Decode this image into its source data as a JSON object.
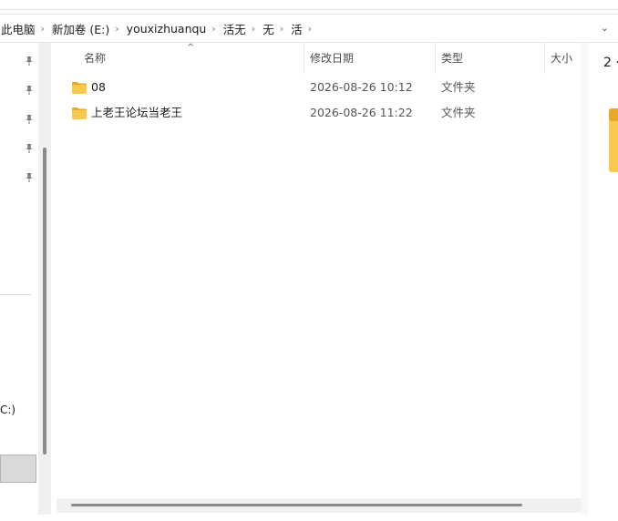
{
  "breadcrumb": [
    {
      "label": "此电脑"
    },
    {
      "label": "新加卷 (E:)"
    },
    {
      "label": "youxizhuanqu"
    },
    {
      "label": "活无"
    },
    {
      "label": "无"
    },
    {
      "label": "活"
    }
  ],
  "nav": {
    "drive_label": "C:)"
  },
  "columns": {
    "name": "名称",
    "date": "修改日期",
    "type": "类型",
    "size": "大小"
  },
  "files": [
    {
      "name": "08",
      "date": "2026-08-26 10:12",
      "type": "文件夹"
    },
    {
      "name": "上老王论坛当老王",
      "date": "2026-08-26 11:22",
      "type": "文件夹"
    }
  ],
  "preview": {
    "count_text": "2 ·"
  },
  "colors": {
    "folder_body": "#f8c94a",
    "folder_tab": "#e8a92a"
  },
  "icons": {
    "pin": "pin-icon",
    "folder": "folder-icon",
    "chevron": "chevron-right-icon",
    "sort": "sort-up-icon"
  }
}
